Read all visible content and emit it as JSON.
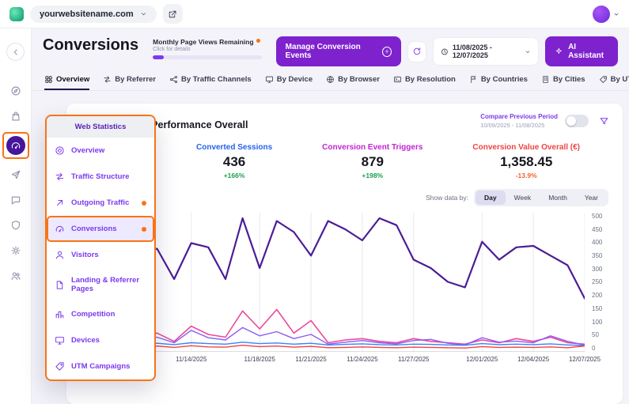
{
  "colors": {
    "accent_purple": "#7e22ce",
    "menu_purple": "#7c3aed",
    "sidebar_active_purple": "#46169c",
    "annotation_orange": "#f97316",
    "delta_green": "#16a34a",
    "delta_orange": "#ef6430"
  },
  "topbar": {
    "domain": "yourwebsitename.com"
  },
  "header": {
    "title": "Conversions",
    "page_views_label": "Monthly Page Views Remaining",
    "page_views_sub": "Click for details",
    "manage_button": "Manage Conversion Events",
    "date_range": "11/08/2025 - 12/07/2025",
    "ai_button": "AI Assistant"
  },
  "tabs": [
    {
      "label": "Overview",
      "icon": "grid-icon",
      "active": true
    },
    {
      "label": "By Referrer",
      "icon": "referrer-arrows-icon"
    },
    {
      "label": "By Traffic Channels",
      "icon": "nodes-icon"
    },
    {
      "label": "By Device",
      "icon": "monitor-icon"
    },
    {
      "label": "By Browser",
      "icon": "globe-icon"
    },
    {
      "label": "By Resolution",
      "icon": "screen-icon"
    },
    {
      "label": "By Countries",
      "icon": "flag-icon"
    },
    {
      "label": "By Cities",
      "icon": "building-icon"
    },
    {
      "label": "By UTM Campaign",
      "icon": "tag-icon"
    }
  ],
  "panel": {
    "title": "Conversions Performance Overall",
    "compare_label": "Compare Previous Period",
    "compare_range": "10/09/2025 - 11/08/2025",
    "compare_toggle_on": false,
    "show_data_by": "Show data by:",
    "granularity": [
      "Day",
      "Week",
      "Month",
      "Year"
    ],
    "granularity_selected": "Day"
  },
  "metrics": [
    {
      "label": "Converted Sessions",
      "value": "436",
      "delta": "+166%",
      "label_color": "#2563eb",
      "delta_color": "#16a34a"
    },
    {
      "label": "Conversion Event Triggers",
      "value": "879",
      "delta": "+198%",
      "label_color": "#c026d3",
      "delta_color": "#16a34a"
    },
    {
      "label": "Conversion Value Overall (€)",
      "value": "1,358.45",
      "delta": "-13.9%",
      "label_color": "#ef4444",
      "delta_color": "#ef6430"
    }
  ],
  "menu": {
    "header": "Web Statistics",
    "items": [
      {
        "label": "Overview",
        "icon": "donut-icon"
      },
      {
        "label": "Traffic Structure",
        "icon": "arrows-icon"
      },
      {
        "label": "Outgoing Traffic",
        "icon": "arrow-up-right-icon",
        "dot": true
      },
      {
        "label": "Conversions",
        "icon": "speedometer-icon",
        "active": true,
        "dot": true
      },
      {
        "label": "Visitors",
        "icon": "person-icon"
      },
      {
        "label": "Landing & Referrer Pages",
        "icon": "document-icon"
      },
      {
        "label": "Competition",
        "icon": "podium-icon"
      },
      {
        "label": "Devices",
        "icon": "monitor-icon"
      },
      {
        "label": "UTM Campaigns",
        "icon": "tag-icon"
      }
    ]
  },
  "chart_data": {
    "type": "line",
    "x": [
      "11/08/2025",
      "11/09/2025",
      "11/10/2025",
      "11/11/2025",
      "11/12/2025",
      "11/13/2025",
      "11/14/2025",
      "11/15/2025",
      "11/16/2025",
      "11/17/2025",
      "11/18/2025",
      "11/19/2025",
      "11/20/2025",
      "11/21/2025",
      "11/22/2025",
      "11/23/2025",
      "11/24/2025",
      "11/25/2025",
      "11/26/2025",
      "11/27/2025",
      "11/28/2025",
      "11/29/2025",
      "11/30/2025",
      "12/01/2025",
      "12/02/2025",
      "12/03/2025",
      "12/04/2025",
      "12/05/2025",
      "12/06/2025",
      "12/07/2025"
    ],
    "xticks": [
      "11/14/2025",
      "11/18/2025",
      "11/21/2025",
      "11/24/2025",
      "11/27/2025",
      "12/01/2025",
      "12/04/2025",
      "12/07/2025"
    ],
    "yticks": [
      0,
      50,
      100,
      150,
      200,
      250,
      300,
      350,
      400,
      450,
      500
    ],
    "ylim": [
      0,
      500
    ],
    "grid": "vertical",
    "legend": "none",
    "series": [
      {
        "name": "dark-purple",
        "color": "#4a1d96",
        "width": 2.2,
        "values": [
          455,
          430,
          400,
          350,
          370,
          260,
          390,
          375,
          260,
          480,
          300,
          470,
          430,
          345,
          470,
          440,
          400,
          480,
          455,
          330,
          300,
          250,
          230,
          395,
          330,
          375,
          380,
          345,
          310,
          190
        ]
      },
      {
        "name": "magenta",
        "color": "#ec4899",
        "width": 1.6,
        "values": [
          60,
          45,
          55,
          40,
          65,
          35,
          90,
          60,
          50,
          145,
          80,
          150,
          65,
          110,
          30,
          40,
          45,
          35,
          30,
          45,
          35,
          30,
          25,
          40,
          30,
          45,
          35,
          50,
          30,
          25
        ]
      },
      {
        "name": "violet",
        "color": "#8b5cf6",
        "width": 1.4,
        "values": [
          50,
          38,
          45,
          35,
          50,
          30,
          75,
          48,
          40,
          85,
          55,
          70,
          45,
          60,
          25,
          32,
          38,
          30,
          26,
          38,
          42,
          28,
          22,
          48,
          32,
          36,
          30,
          55,
          35,
          22
        ]
      },
      {
        "name": "blue",
        "color": "#3b82f6",
        "width": 1.4,
        "values": [
          26,
          24,
          27,
          25,
          28,
          23,
          30,
          27,
          25,
          32,
          27,
          29,
          25,
          28,
          22,
          24,
          26,
          23,
          22,
          25,
          24,
          22,
          21,
          27,
          23,
          25,
          23,
          26,
          22,
          20
        ]
      },
      {
        "name": "red",
        "color": "#ef4444",
        "width": 1.4,
        "values": [
          16,
          14,
          17,
          15,
          18,
          13,
          19,
          15,
          14,
          21,
          16,
          18,
          14,
          17,
          12,
          13,
          15,
          13,
          12,
          14,
          13,
          12,
          11,
          16,
          13,
          14,
          13,
          15,
          12,
          18
        ]
      }
    ]
  }
}
